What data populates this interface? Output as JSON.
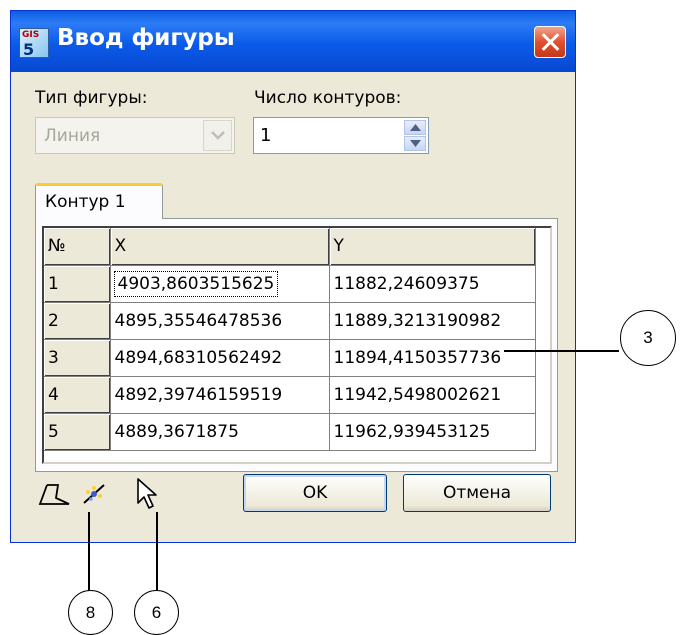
{
  "window": {
    "title": "Ввод фигуры",
    "app_icon_top": "GIS",
    "app_icon_num": "5"
  },
  "shape_type": {
    "label": "Тип фигуры:",
    "value": "Линия",
    "enabled": false
  },
  "contour_count": {
    "label": "Число контуров:",
    "value": "1"
  },
  "tab": {
    "label": "Контур 1"
  },
  "table": {
    "headers": [
      "№",
      "X",
      "Y"
    ],
    "rows": [
      [
        "1",
        "4903,8603515625",
        "11882,24609375"
      ],
      [
        "2",
        "4895,35546478536",
        "11889,3213190982"
      ],
      [
        "3",
        "4894,68310562492",
        "11894,4150357736"
      ],
      [
        "4",
        "4892,39746159519",
        "11942,5498002621"
      ],
      [
        "5",
        "4889,3671875",
        "11962,939453125"
      ]
    ]
  },
  "toolbar_icons": [
    "polygon-tool-icon",
    "point-pick-icon",
    "cursor-arrow-icon"
  ],
  "buttons": {
    "ok": "OK",
    "cancel": "Отмена"
  },
  "callouts": {
    "table": "3",
    "point_tool": "8",
    "cursor_tool": "6"
  }
}
